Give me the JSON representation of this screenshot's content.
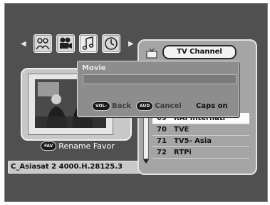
{
  "nav": {
    "prev_arrow": "◀",
    "next_arrow": "▶",
    "icons": [
      "people-icon",
      "film-camera-icon",
      "music-note-icon",
      "clock-icon"
    ]
  },
  "preview": {
    "fav_key": "FAV",
    "rename_label": "Rename Favor"
  },
  "satellite_info": "C_Asiasat 2  4000.H.28125.3",
  "channel_list": {
    "tab_label": "TV Channel",
    "rows": [
      {
        "num": "69",
        "name": "RAI Internati"
      },
      {
        "num": "70",
        "name": "TVE"
      },
      {
        "num": "71",
        "name": "TV5- Asia"
      },
      {
        "num": "72",
        "name": "RTPi"
      }
    ]
  },
  "dialog": {
    "title": "Movie",
    "input_value": "",
    "back_key": "VOL-",
    "back_label": "Back",
    "cancel_key": "AUD",
    "cancel_label": "Cancel",
    "caps_label": "Caps on"
  },
  "colors": {
    "background": "#505050",
    "panel": "#a5a5a5",
    "dialog": "#8d8d8d",
    "selected_row": "#fbfbfb"
  }
}
